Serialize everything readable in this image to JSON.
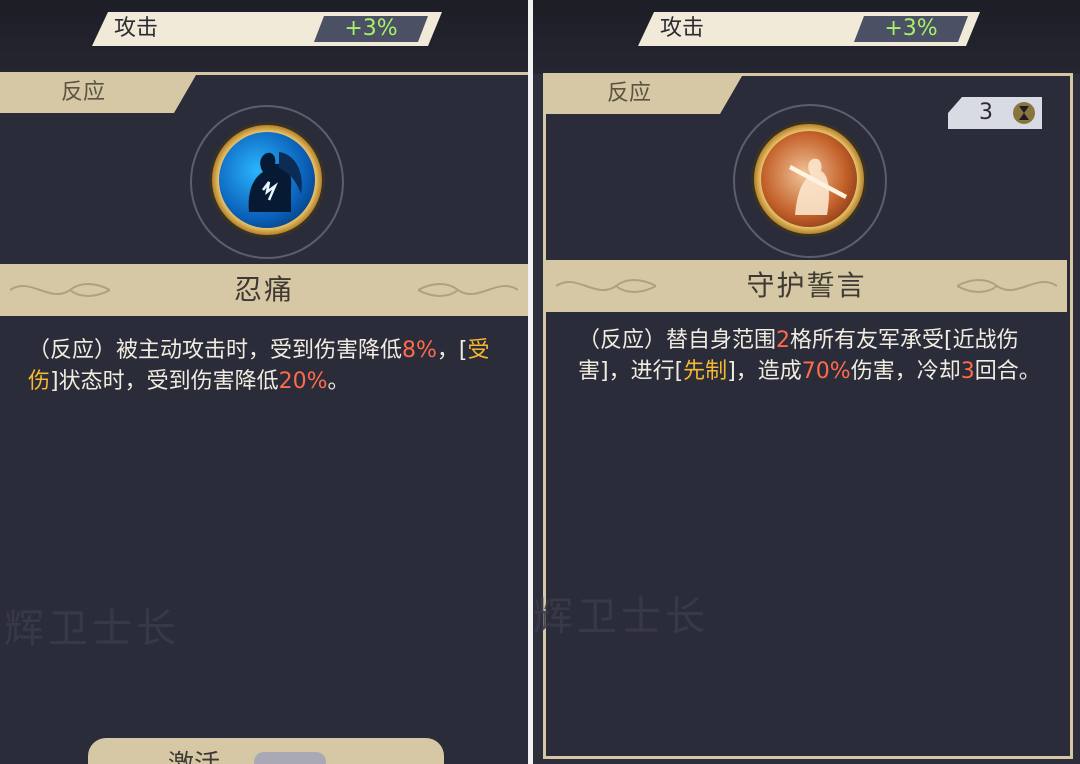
{
  "left": {
    "stat": {
      "label": "攻击",
      "value": "+3%"
    },
    "tag": "反应",
    "skill_name": "忍痛",
    "icon": "silhouette-lightning-icon",
    "description": [
      {
        "text": "（反应）被主动攻击时，受到伤害降低",
        "style": "normal"
      },
      {
        "text": "8%",
        "style": "red"
      },
      {
        "text": "，[",
        "style": "normal"
      },
      {
        "text": "受伤",
        "style": "gold"
      },
      {
        "text": "]状态时，受到伤害降低",
        "style": "normal"
      },
      {
        "text": "20%",
        "style": "red"
      },
      {
        "text": "。",
        "style": "normal"
      }
    ],
    "watermark": "辉卫士长",
    "bottom_button": "激活"
  },
  "right": {
    "stat": {
      "label": "攻击",
      "value": "+3%"
    },
    "tag": "反应",
    "cooldown": "3",
    "skill_name": "守护誓言",
    "icon": "sword-guardian-icon",
    "description": [
      {
        "text": "（反应）替自身范围",
        "style": "normal"
      },
      {
        "text": "2",
        "style": "red"
      },
      {
        "text": "格所有友军承受[近战伤害]，进行[",
        "style": "normal"
      },
      {
        "text": "先制",
        "style": "gold"
      },
      {
        "text": "]，造成",
        "style": "normal"
      },
      {
        "text": "70%",
        "style": "red"
      },
      {
        "text": "伤害，冷却",
        "style": "normal"
      },
      {
        "text": "3",
        "style": "red"
      },
      {
        "text": "回合。",
        "style": "normal"
      }
    ],
    "watermark": "辉卫士长"
  },
  "colors": {
    "accent_red": "#ff6a4a",
    "accent_gold": "#f5b830",
    "stat_green": "#a6f06a",
    "frame": "#d6c8a4"
  }
}
